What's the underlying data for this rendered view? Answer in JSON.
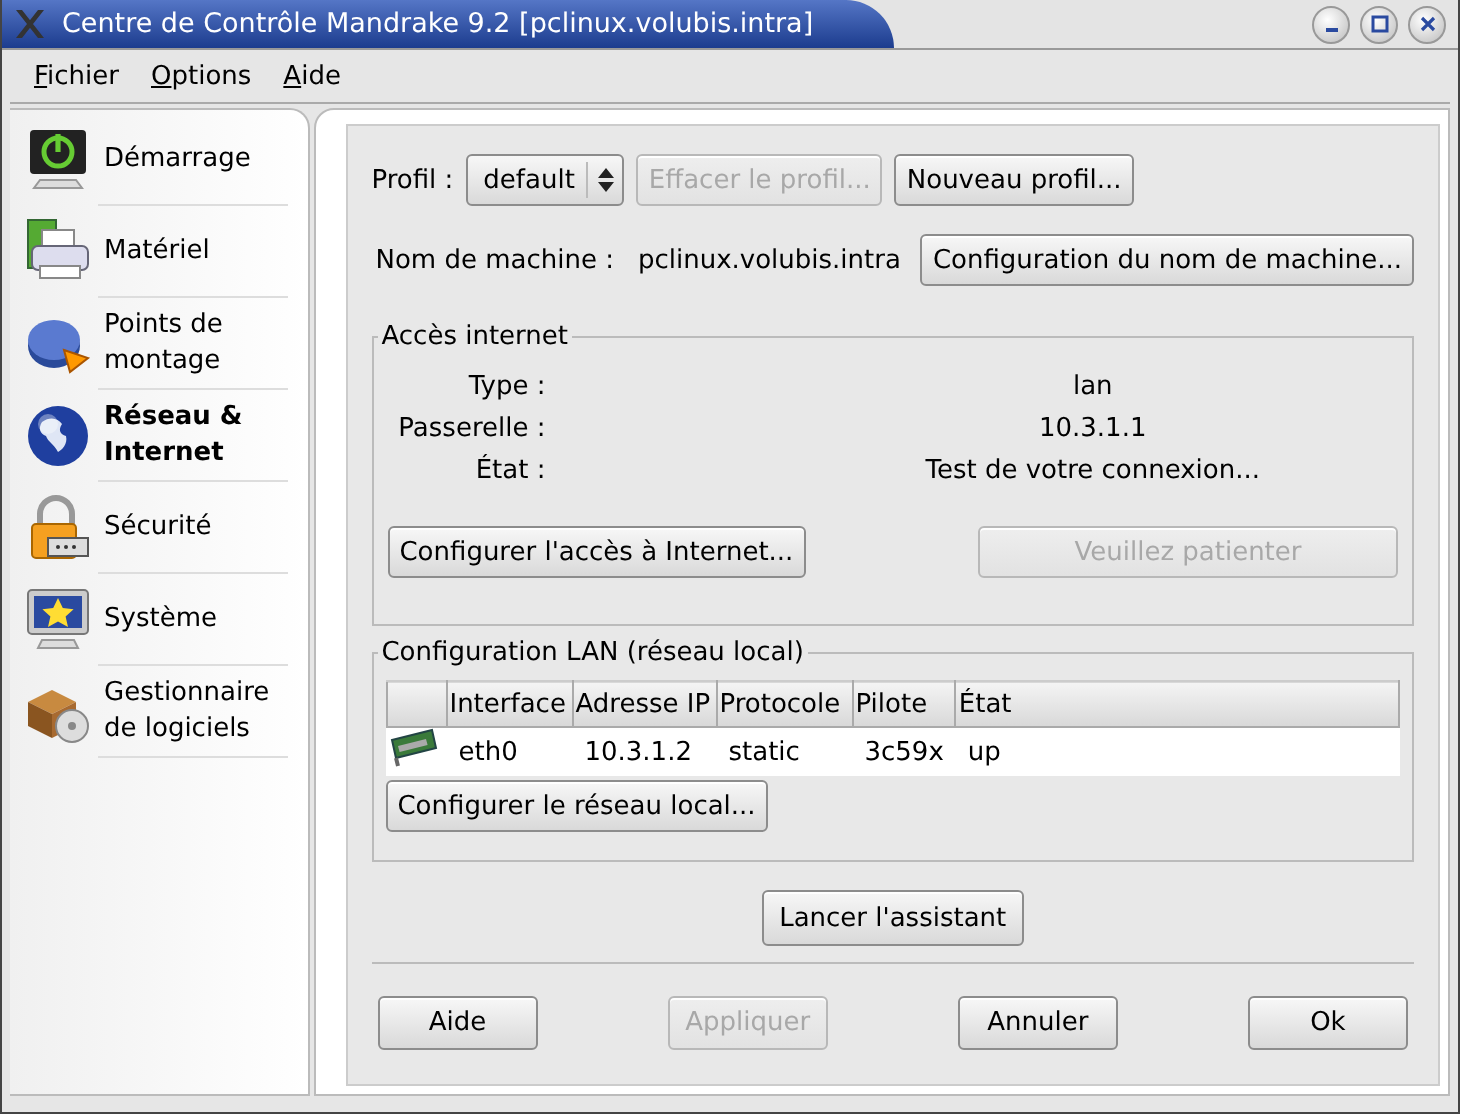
{
  "window": {
    "title": "Centre de Contrôle Mandrake 9.2 [pclinux.volubis.intra]"
  },
  "menu": [
    "Fichier",
    "Options",
    "Aide"
  ],
  "sidebar": {
    "items": [
      {
        "label": "Démarrage",
        "kind": "power",
        "selected": false
      },
      {
        "label": "Matériel",
        "kind": "printer",
        "selected": false
      },
      {
        "label": "Points de montage",
        "kind": "disk",
        "selected": false
      },
      {
        "label": "Réseau & Internet",
        "kind": "globe",
        "selected": true
      },
      {
        "label": "Sécurité",
        "kind": "lock",
        "selected": false
      },
      {
        "label": "Système",
        "kind": "monitor",
        "selected": false
      },
      {
        "label": "Gestionnaire de logiciels",
        "kind": "package",
        "selected": false
      }
    ]
  },
  "profile": {
    "label": "Profil :",
    "value": "default",
    "buttons": [
      {
        "label": "Effacer le profil...",
        "disabled": true
      },
      {
        "label": "Nouveau profil...",
        "disabled": false
      }
    ]
  },
  "hostname": {
    "label": "Nom de machine :",
    "value": "pclinux.volubis.intra",
    "button": {
      "label": "Configuration du nom de machine...",
      "disabled": false
    }
  },
  "internet_access": {
    "title": "Accès internet",
    "fields": [
      {
        "label": "Type :",
        "value": "lan"
      },
      {
        "label": "Passerelle :",
        "value": "10.3.1.1"
      },
      {
        "label": "État :",
        "value": "Test de votre connexion..."
      }
    ],
    "buttons": [
      {
        "label": "Configurer l'accès à Internet...",
        "disabled": false
      },
      {
        "label": "Veuillez patienter",
        "disabled": true
      }
    ]
  },
  "lan": {
    "title": "Configuration LAN (réseau local)",
    "columns": [
      "Interface",
      "Adresse IP",
      "Protocole",
      "Pilote",
      "État"
    ],
    "rows": [
      {
        "cells": [
          "eth0",
          "10.3.1.2",
          "static",
          "3c59x",
          "up"
        ]
      }
    ],
    "button": {
      "label": "Configurer le réseau local...",
      "disabled": false
    }
  },
  "wizard_button": {
    "label": "Lancer l'assistant",
    "disabled": false
  },
  "footer_buttons": [
    {
      "label": "Aide",
      "disabled": false
    },
    {
      "label": "Appliquer",
      "disabled": true
    },
    {
      "label": "Annuler",
      "disabled": false
    },
    {
      "label": "Ok",
      "disabled": false
    }
  ]
}
